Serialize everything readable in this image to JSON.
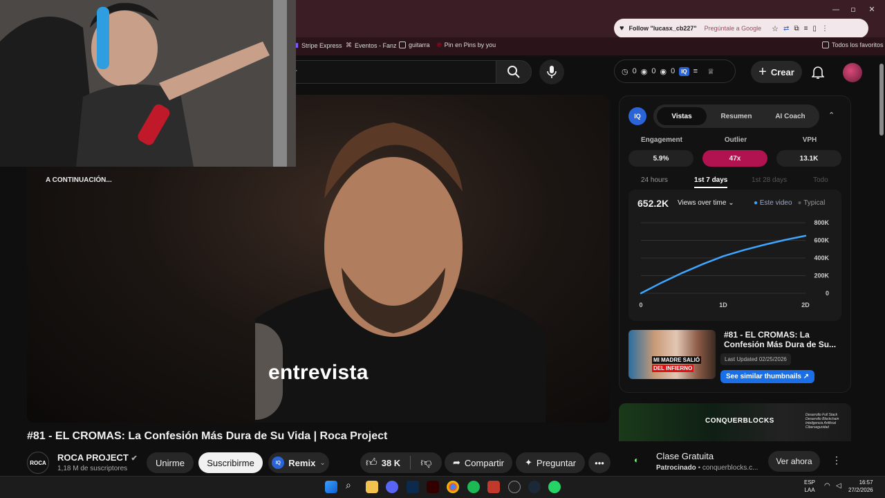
{
  "browser": {
    "omnibox_popup": {
      "follow_text": "Follow \"lucasx_cb227\"",
      "ask_google": "Pregúntale a Google"
    },
    "bookmarks": [
      "Stripe Express",
      "Eventos - Fanz",
      "guitarra",
      "Pin en Pins by you"
    ],
    "all_bookmarks": "Todos los favoritos"
  },
  "header": {
    "search_placeholder": "r",
    "stats": [
      "0",
      "0",
      "0"
    ],
    "iq_label": "IQ",
    "create_label": "Crear"
  },
  "video": {
    "caption": "entrevista",
    "up_next": "A CONTINUACIÓN...",
    "title": "#81 - EL CROMAS: La Confesión Más Dura de Su Vida | Roca Project"
  },
  "channel": {
    "avatar_text": "ROCA",
    "name": "ROCA PROJECT",
    "subs": "1,18 M de suscriptores",
    "join": "Unirme",
    "subscribe": "Suscribirme",
    "remix": "Remix",
    "likes": "38 K",
    "share": "Compartir",
    "ask": "Preguntar"
  },
  "vidiq": {
    "logo": "IQ",
    "tabs": [
      "Vistas",
      "Resumen",
      "AI Coach"
    ],
    "metrics": [
      {
        "label": "Engagement",
        "value": "5.9%"
      },
      {
        "label": "Outlier",
        "value": "47x"
      },
      {
        "label": "VPH",
        "value": "13.1K"
      }
    ],
    "ranges": [
      "24 hours",
      "1st 7 days",
      "1st 28 days",
      "Todo"
    ],
    "active_range": "1st 7 days",
    "total": "652.2K",
    "metric_select": "Views over time",
    "legend": [
      "Este video",
      "Typical"
    ],
    "thumb_title": "#81 - EL CROMAS: La Confesión Más Dura de Su...",
    "last_updated": "Last Updated 02/25/2026",
    "similar_btn": "See similar thumbnails",
    "thumb_text": [
      "MI MADRE SALIÓ",
      "DEL INFIERNO"
    ]
  },
  "chart_data": {
    "type": "line",
    "x_ticks": [
      "0",
      "1D",
      "2D"
    ],
    "y_ticks": [
      "0",
      "200K",
      "400K",
      "600K",
      "800K"
    ],
    "ylim": [
      0,
      800000
    ],
    "xlim": [
      0,
      2
    ],
    "series": [
      {
        "name": "Este video",
        "color": "#3ea6ff",
        "x": [
          0,
          0.25,
          0.5,
          0.75,
          1.0,
          1.25,
          1.5,
          1.75,
          2.0
        ],
        "y": [
          0,
          120000,
          230000,
          330000,
          420000,
          490000,
          550000,
          605000,
          652200
        ]
      }
    ]
  },
  "ad": {
    "brand": "CONQUERBLOCKS",
    "banner_lines": [
      "Desarrollo Full Stack",
      "Desarrollo Blockchain",
      "Inteligencia Artificial",
      "Ciberseguridad"
    ],
    "title": "Clase Gratuita",
    "sponsored": "Patrocinado",
    "domain": "conquerblocks.c...",
    "cta": "Ver ahora"
  },
  "taskbar": {
    "lang": [
      "ESP",
      "LAA"
    ],
    "time": "16:57",
    "date": "27/2/2026"
  },
  "colors": {
    "outlier": "#b0134f",
    "accent_blue": "#3ea6ff",
    "vidiq_blue": "#2b63d8"
  }
}
